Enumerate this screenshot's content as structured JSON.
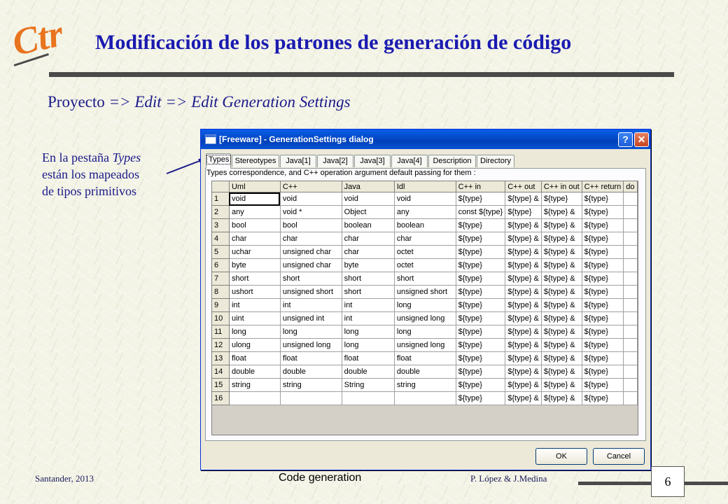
{
  "logo": {
    "text": "Ctr",
    "color": "#e8741e"
  },
  "slide": {
    "title": "Modificación de los patrones de generación de código",
    "title_color": "#1a1ab0",
    "breadcrumb": {
      "part1": "Proyecto",
      "sep1": " => ",
      "part2": "Edit",
      "sep2": " => ",
      "part3": "Edit Generation Settings"
    },
    "note": {
      "line1_prefix": "En la pestaña ",
      "line1_em": "Types",
      "line2": "están los mapeados",
      "line3": "de tipos primitivos"
    }
  },
  "dialog": {
    "title": "[Freeware] - GenerationSettings dialog",
    "help_label": "?",
    "close_label": "✕",
    "tabs": [
      "Types",
      "Stereotypes",
      "Java[1]",
      "Java[2]",
      "Java[3]",
      "Java[4]",
      "Description",
      "Directory"
    ],
    "active_tab": "Types",
    "caption": "Types correspondence, and C++ operation argument default passing for them :",
    "table": {
      "headers": [
        "",
        "Uml",
        "C++",
        "Java",
        "Idl",
        "C++ in",
        "C++ out",
        "C++ in out",
        "C++ return",
        "do"
      ],
      "rows": [
        [
          "1",
          "void",
          "void",
          "void",
          "void",
          "${type}",
          "${type} &",
          "${type}",
          "${type}",
          ""
        ],
        [
          "2",
          "any",
          "void *",
          "Object",
          "any",
          "const ${type}",
          "${type}",
          "${type} &",
          "${type}",
          ""
        ],
        [
          "3",
          "bool",
          "bool",
          "boolean",
          "boolean",
          "${type}",
          "${type} &",
          "${type} &",
          "${type}",
          ""
        ],
        [
          "4",
          "char",
          "char",
          "char",
          "char",
          "${type}",
          "${type} &",
          "${type} &",
          "${type}",
          ""
        ],
        [
          "5",
          "uchar",
          "unsigned char",
          "char",
          "octet",
          "${type}",
          "${type} &",
          "${type} &",
          "${type}",
          ""
        ],
        [
          "6",
          "byte",
          "unsigned char",
          "byte",
          "octet",
          "${type}",
          "${type} &",
          "${type} &",
          "${type}",
          ""
        ],
        [
          "7",
          "short",
          "short",
          "short",
          "short",
          "${type}",
          "${type} &",
          "${type} &",
          "${type}",
          ""
        ],
        [
          "8",
          "ushort",
          "unsigned short",
          "short",
          "unsigned short",
          "${type}",
          "${type} &",
          "${type} &",
          "${type}",
          ""
        ],
        [
          "9",
          "int",
          "int",
          "int",
          "long",
          "${type}",
          "${type} &",
          "${type} &",
          "${type}",
          ""
        ],
        [
          "10",
          "uint",
          "unsigned int",
          "int",
          "unsigned long",
          "${type}",
          "${type} &",
          "${type} &",
          "${type}",
          ""
        ],
        [
          "11",
          "long",
          "long",
          "long",
          "long",
          "${type}",
          "${type} &",
          "${type} &",
          "${type}",
          ""
        ],
        [
          "12",
          "ulong",
          "unsigned long",
          "long",
          "unsigned long",
          "${type}",
          "${type} &",
          "${type} &",
          "${type}",
          ""
        ],
        [
          "13",
          "float",
          "float",
          "float",
          "float",
          "${type}",
          "${type} &",
          "${type} &",
          "${type}",
          ""
        ],
        [
          "14",
          "double",
          "double",
          "double",
          "double",
          "${type}",
          "${type} &",
          "${type} &",
          "${type}",
          ""
        ],
        [
          "15",
          "string",
          "string",
          "String",
          "string",
          "${type}",
          "${type} &",
          "${type} &",
          "${type}",
          ""
        ],
        [
          "16",
          "",
          "",
          "",
          "",
          "${type}",
          "${type} &",
          "${type} &",
          "${type}",
          ""
        ]
      ]
    },
    "ok_label": "OK",
    "cancel_label": "Cancel"
  },
  "footer": {
    "left": "Santander, 2013",
    "center": "Code generation",
    "right": "P. López & J.Medina",
    "page": "6"
  }
}
